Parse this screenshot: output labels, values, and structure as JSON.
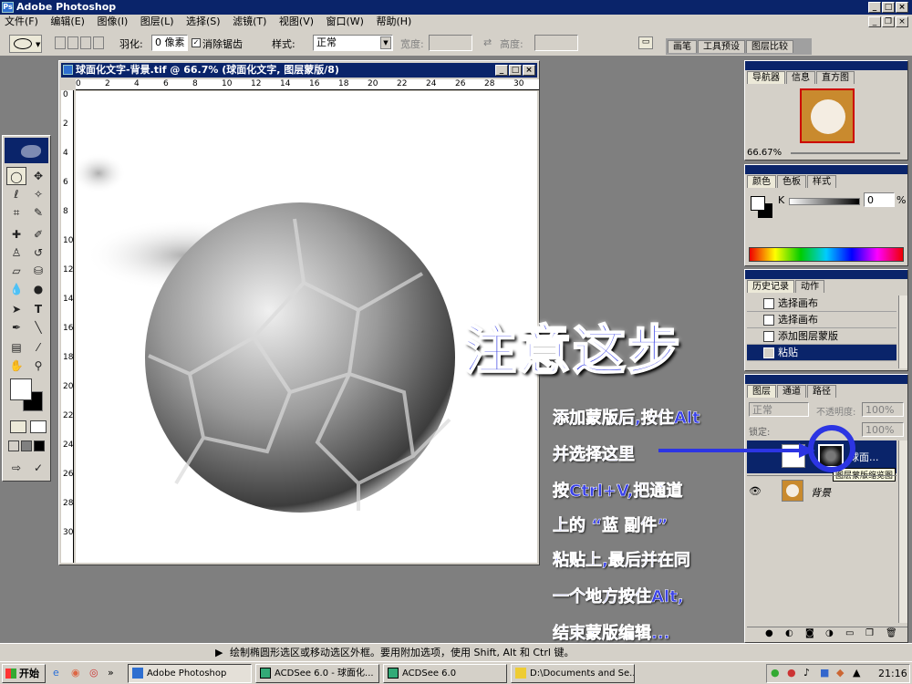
{
  "app": {
    "title": "Adobe Photoshop"
  },
  "menu": [
    "文件(F)",
    "编辑(E)",
    "图像(I)",
    "图层(L)",
    "选择(S)",
    "滤镜(T)",
    "视图(V)",
    "窗口(W)",
    "帮助(H)"
  ],
  "options": {
    "feather_label": "羽化:",
    "feather_value": "0 像素",
    "antialias_label": "消除锯齿",
    "style_label": "样式:",
    "style_value": "正常",
    "width_label": "宽度:",
    "height_label": "高度:",
    "palette_tabs": [
      "画笔",
      "工具预设",
      "图层比较"
    ]
  },
  "document": {
    "title": "球面化文字-背景.tif @ 66.7% (球面化文字, 图层蒙版/8)",
    "ruler_top": [
      "0",
      "2",
      "4",
      "6",
      "8",
      "10",
      "12",
      "14",
      "16",
      "18",
      "20",
      "22",
      "24",
      "26",
      "28",
      "30"
    ],
    "ruler_left": [
      "0",
      "2",
      "4",
      "6",
      "8",
      "10",
      "12",
      "14",
      "16",
      "18",
      "20",
      "22",
      "24",
      "26",
      "28",
      "30"
    ]
  },
  "navigator": {
    "tabs": [
      "导航器",
      "信息",
      "直方图"
    ],
    "zoom": "66.67%"
  },
  "color_panel": {
    "tabs": [
      "颜色",
      "色板",
      "样式"
    ],
    "channel": "K",
    "value": "0",
    "unit": "%"
  },
  "history": {
    "tabs": [
      "历史记录",
      "动作"
    ],
    "items": [
      "选择画布",
      "选择画布",
      "添加图层蒙版",
      "粘贴"
    ]
  },
  "layers": {
    "tabs": [
      "图层",
      "通道",
      "路径"
    ],
    "blend": "正常",
    "opacity_label": "不透明度:",
    "opacity": "100%",
    "lock_label": "锁定:",
    "fill": "100%",
    "layer1_name": "球面...",
    "tooltip": "图层蒙版缩览图",
    "layer2_name": "背景"
  },
  "annotation": {
    "title": "注意这步",
    "lines": [
      "添加蒙版后,按住Alt",
      "并选择这里",
      "按Ctrl+V,把通道",
      "上的 “蓝 副件”",
      "粘贴上,最后并在同",
      "一个地方按住Alt,",
      "结束蒙版编辑..."
    ]
  },
  "status": {
    "text": "绘制椭圆形选区或移动选区外框。要用附加选项，使用 Shift, Alt 和 Ctrl 键。"
  },
  "taskbar": {
    "start": "开始",
    "tasks": [
      "Adobe Photoshop",
      "ACDSee 6.0 - 球面化...",
      "ACDSee 6.0",
      "D:\\Documents and Se..."
    ],
    "clock": "21:16"
  },
  "colors": {
    "titlebar": "#0a246a",
    "chrome": "#d4d0c8",
    "workspace": "#7f7f7f",
    "annotation": "#2c35e3"
  }
}
